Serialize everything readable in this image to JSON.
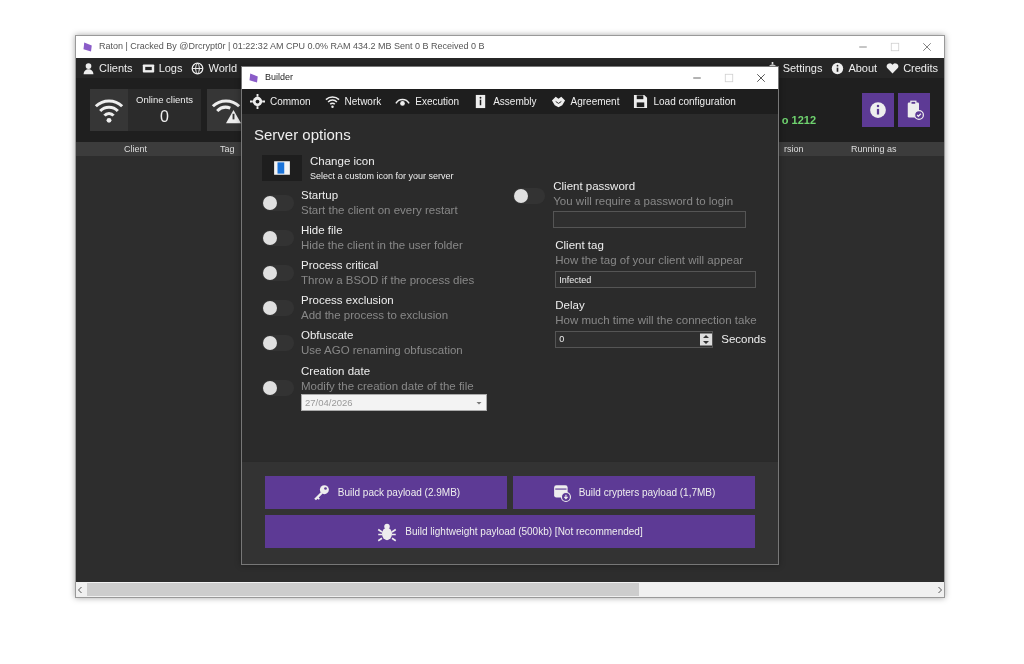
{
  "main_window": {
    "title": "Raton | Cracked By @Drcrypt0r | 01:22:32 AM CPU 0.0% RAM 434.2 MB Sent 0 B Received 0 B",
    "menu_left": [
      "Clients",
      "Logs",
      "World"
    ],
    "menu_right": [
      "Settings",
      "About",
      "Credits"
    ],
    "stats": [
      {
        "label": "Online clients",
        "value": "0"
      }
    ],
    "port_text": "o 1212",
    "columns": [
      "Client",
      "Tag",
      "rsion",
      "Running as"
    ]
  },
  "builder": {
    "title": "Builder",
    "tabs": [
      "Common",
      "Network",
      "Execution",
      "Assembly",
      "Agreement",
      "Load configuration"
    ],
    "heading": "Server options",
    "change_icon": {
      "title": "Change icon",
      "subtitle": "Select a custom icon for your server"
    },
    "options": [
      {
        "kind": "toggle",
        "title": "Startup",
        "description": "Start the client on every restart",
        "on": false
      },
      {
        "kind": "toggle",
        "title": "Hide file",
        "description": "Hide the client in the user folder",
        "on": false
      },
      {
        "kind": "toggle",
        "title": "Process critical",
        "description": "Throw a BSOD if the process dies",
        "on": false
      },
      {
        "kind": "toggle",
        "title": "Process exclusion",
        "description": "Add the process to exclusion",
        "on": false
      },
      {
        "kind": "toggle",
        "title": "Obfuscate",
        "description": "Use AGO renaming obfuscation",
        "on": false
      },
      {
        "kind": "date",
        "title": "Creation date",
        "description": "Modify the creation date of the file",
        "on": false,
        "date": "27/04/2026",
        "disabled": true
      }
    ],
    "fields": [
      {
        "kind": "password",
        "title": "Client password",
        "description": "You will require a password to login",
        "on": false
      },
      {
        "kind": "text",
        "title": "Client tag",
        "description": "How the tag of your client will appear",
        "value": "Infected"
      },
      {
        "kind": "number",
        "title": "Delay",
        "description": "How much time will the connection take",
        "value": "0",
        "unit": "Seconds"
      }
    ],
    "buttons": [
      "Build pack payload (2.9MB)",
      "Build crypters payload (1,7MB)",
      "Build lightweight payload  (500kb) [Not recommended]"
    ]
  }
}
